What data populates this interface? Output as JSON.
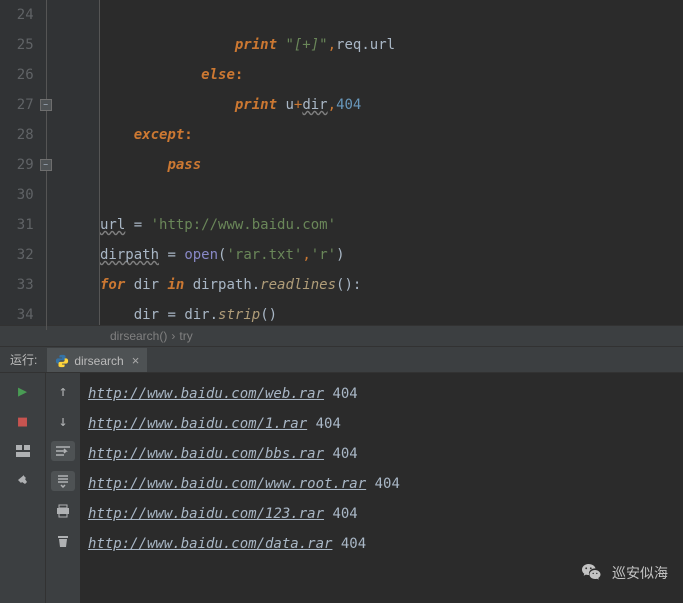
{
  "lines": [
    {
      "num": "24",
      "fold": false
    },
    {
      "num": "25",
      "fold": false
    },
    {
      "num": "26",
      "fold": false
    },
    {
      "num": "27",
      "fold": true
    },
    {
      "num": "28",
      "fold": false
    },
    {
      "num": "29",
      "fold": true
    },
    {
      "num": "30",
      "fold": false
    },
    {
      "num": "31",
      "fold": false
    },
    {
      "num": "32",
      "fold": false
    },
    {
      "num": "33",
      "fold": false
    },
    {
      "num": "34",
      "fold": false
    }
  ],
  "code": {
    "l25_print": "print",
    "l25_str": " \"[+]\"",
    "l25_req": "req",
    "l25_url": "url",
    "l26_else": "else",
    "l27_print": "print",
    "l27_u": "u",
    "l27_dir": "dir",
    "l27_404": "404",
    "l28_except": "except",
    "l29_pass": "pass",
    "l31_url": "url",
    "l31_eq": " = ",
    "l31_str": "'http://www.baidu.com'",
    "l32_dirpath": "dirpath",
    "l32_eq": " = ",
    "l32_open": "open",
    "l32_arg1": "'rar.txt'",
    "l32_arg2": "'r'",
    "l33_for": "for",
    "l33_dir": " dir ",
    "l33_in": "in",
    "l33_dirpath": " dirpath.",
    "l33_readlines": "readlines",
    "l34_dir1": "dir",
    "l34_eq": " = ",
    "l34_dir2": "dir.",
    "l34_strip": "strip"
  },
  "breadcrumb": {
    "fn": "dirsearch()",
    "sep": "›",
    "item": "try"
  },
  "run": {
    "label": "运行:",
    "tab": "dirsearch"
  },
  "console_lines": [
    {
      "url": "http://www.baidu.com/web.rar",
      "code": "404"
    },
    {
      "url": "http://www.baidu.com/1.rar",
      "code": "404"
    },
    {
      "url": "http://www.baidu.com/bbs.rar",
      "code": "404"
    },
    {
      "url": "http://www.baidu.com/www.root.rar",
      "code": "404"
    },
    {
      "url": "http://www.baidu.com/123.rar",
      "code": "404"
    },
    {
      "url": "http://www.baidu.com/data.rar",
      "code": "404"
    }
  ],
  "watermark": "巡安似海"
}
